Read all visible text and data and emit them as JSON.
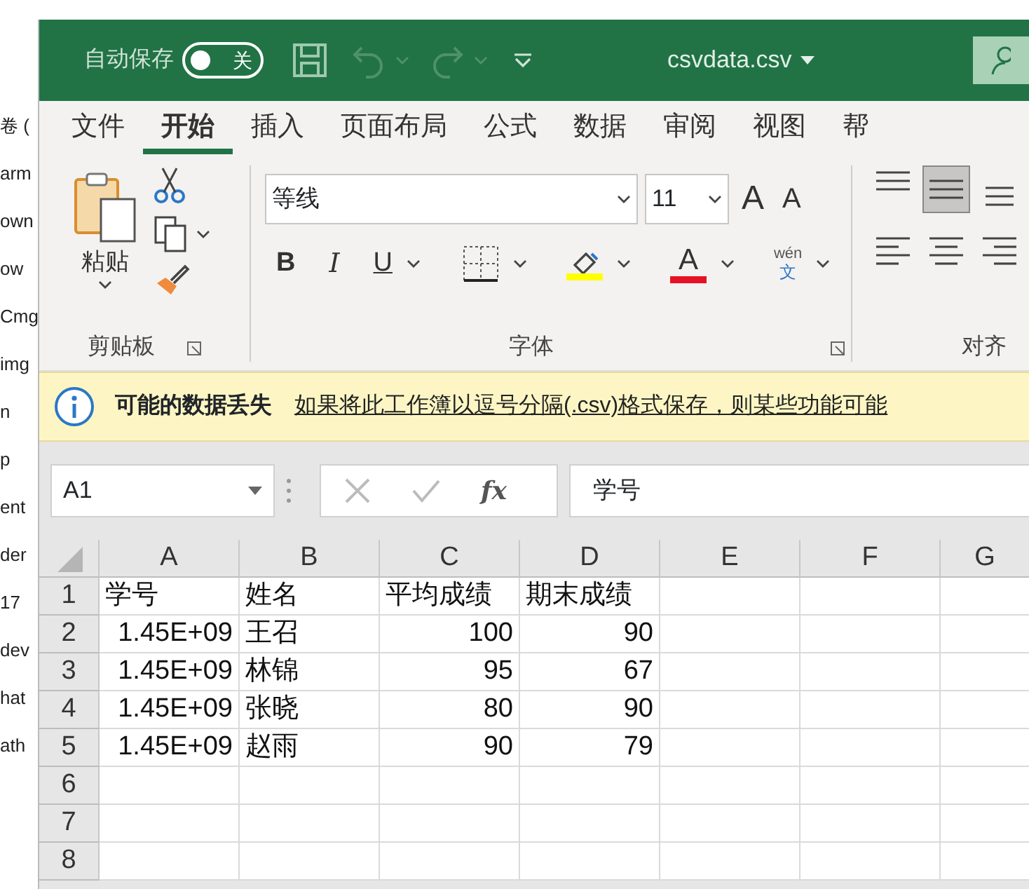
{
  "background_list": {
    "items": [
      "卷 (",
      "arm",
      "own",
      "ow",
      "Cmg",
      "img",
      "n",
      "p",
      "ent",
      "der",
      "17",
      "dev",
      "hat",
      "ath"
    ]
  },
  "title_bar": {
    "autosave_label": "自动保存",
    "autosave": {
      "on": false,
      "label": "关"
    },
    "filename": "csvdata.csv"
  },
  "menu_tabs": [
    {
      "label": "文件",
      "selected": false
    },
    {
      "label": "开始",
      "selected": true
    },
    {
      "label": "插入",
      "selected": false
    },
    {
      "label": "页面布局",
      "selected": false
    },
    {
      "label": "公式",
      "selected": false
    },
    {
      "label": "数据",
      "selected": false
    },
    {
      "label": "审阅",
      "selected": false
    },
    {
      "label": "视图",
      "selected": false
    },
    {
      "label": "帮",
      "selected": false
    }
  ],
  "ribbon": {
    "clipboard": {
      "paste": "粘贴",
      "group_label": "剪贴板"
    },
    "font": {
      "font_name": "等线",
      "font_size": "11",
      "grow": "A",
      "shrink": "A",
      "bold": "B",
      "italic": "I",
      "underline": "U",
      "font_color": "A",
      "phonetic_top": "wén",
      "phonetic_bottom": "文",
      "group_label": "字体"
    },
    "alignment": {
      "group_label": "对齐",
      "buttons": [
        {
          "kind": "top",
          "selected": false
        },
        {
          "kind": "middle",
          "selected": true
        },
        {
          "kind": "bottom",
          "selected": false
        },
        {
          "kind": "left",
          "selected": false
        },
        {
          "kind": "center",
          "selected": false
        },
        {
          "kind": "right",
          "selected": false
        }
      ]
    }
  },
  "info_bar": {
    "title": "可能的数据丢失",
    "message": "如果将此工作簿以逗号分隔(.csv)格式保存，则某些功能可能"
  },
  "formula_bar": {
    "name_box": "A1",
    "fx": "fx",
    "value": "学号"
  },
  "sheet": {
    "columns": [
      "A",
      "B",
      "C",
      "D",
      "E",
      "F",
      "G"
    ],
    "rows": [
      {
        "header": "1",
        "cells": [
          {
            "text": "学号",
            "kind": "text"
          },
          {
            "text": "姓名",
            "kind": "text"
          },
          {
            "text": "平均成绩",
            "kind": "text"
          },
          {
            "text": "期末成绩",
            "kind": "text"
          }
        ]
      },
      {
        "header": "2",
        "cells": [
          {
            "text": "1.45E+09",
            "kind": "number"
          },
          {
            "text": "王召",
            "kind": "text"
          },
          {
            "text": "100",
            "kind": "number"
          },
          {
            "text": "90",
            "kind": "number"
          }
        ]
      },
      {
        "header": "3",
        "cells": [
          {
            "text": "1.45E+09",
            "kind": "number"
          },
          {
            "text": "林锦",
            "kind": "text"
          },
          {
            "text": "95",
            "kind": "number"
          },
          {
            "text": "67",
            "kind": "number"
          }
        ]
      },
      {
        "header": "4",
        "cells": [
          {
            "text": "1.45E+09",
            "kind": "number"
          },
          {
            "text": "张晓",
            "kind": "text"
          },
          {
            "text": "80",
            "kind": "number"
          },
          {
            "text": "90",
            "kind": "number"
          }
        ]
      },
      {
        "header": "5",
        "cells": [
          {
            "text": "1.45E+09",
            "kind": "number"
          },
          {
            "text": "赵雨",
            "kind": "text"
          },
          {
            "text": "90",
            "kind": "number"
          },
          {
            "text": "79",
            "kind": "number"
          }
        ]
      },
      {
        "header": "6",
        "cells": []
      },
      {
        "header": "7",
        "cells": []
      },
      {
        "header": "8",
        "cells": []
      }
    ]
  }
}
